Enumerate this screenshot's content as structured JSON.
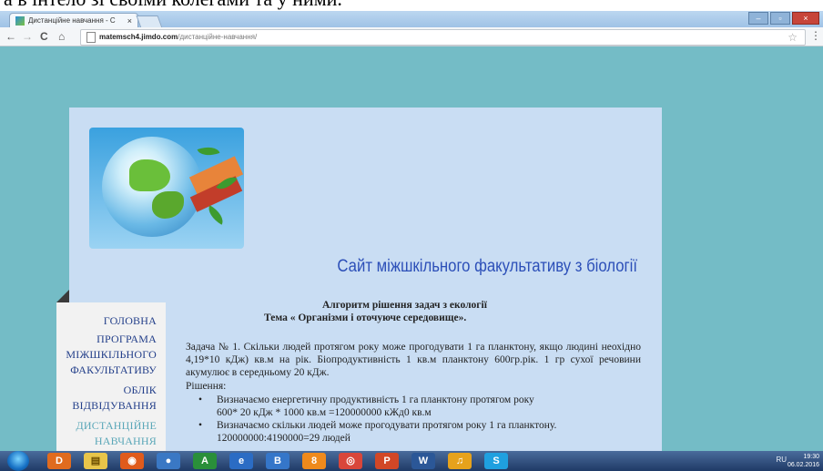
{
  "caption": "а в інтело зі своїми колегами та у ними.",
  "browser": {
    "tab_title": "Дистанційне навчання - С",
    "tab_close": "×",
    "win_min": "‒",
    "win_restore": "▫",
    "win_close": "×",
    "back": "←",
    "forward": "→",
    "reload": "C",
    "home": "⌂",
    "url_host": "matemsch4.jimdo.com",
    "url_path": "/дистанційне-навчання/",
    "bookmark": "☆",
    "menu": "⋮"
  },
  "site": {
    "title": "Сайт міжшкільного факультативу з біології"
  },
  "nav": {
    "items": [
      {
        "label": "ГОЛОВНА"
      },
      {
        "label": "ПРОГРАМА"
      },
      {
        "label": "МІЖШКІЛЬНОГО"
      },
      {
        "label": "ФАКУЛЬТАТИВУ"
      },
      {
        "label": "ОБЛІК"
      },
      {
        "label": "ВІДВІДУВАННЯ"
      },
      {
        "label": "ДИСТАНЦІЙНЕ"
      },
      {
        "label": "НАВЧАННЯ"
      }
    ]
  },
  "article": {
    "heading1": "Алгоритм рішення задач з екології",
    "heading2": "Тема « Організми і оточуюче середовище».",
    "task": "Задача № 1. Скільки людей протягом року може прогодувати 1 га планктону, якщо людині неохідно 4,19*10 кДж) кв.м на рік. Біопродуктивність 1 кв.м планктону 600гр.рік. 1 гр сухої речовини акумулює в середньому 20 кДж.",
    "solution_label": "Рішення:",
    "bullets": [
      {
        "text": "Визначаємо енергетичну продуктивність 1 га планктону протягом року",
        "sub": "600* 20 кДж * 1000 кв.м =120000000 кЖд0 кв.м"
      },
      {
        "text": "Визначаємо скільки людей може прогодувати протягом року 1 га планктону.",
        "sub": "120000000:4190000=29 людей"
      }
    ]
  },
  "taskbar": {
    "lang": "RU",
    "time": "19:30",
    "date": "06.02.2016",
    "apps": [
      "D",
      "▤",
      "◉",
      "●",
      "A",
      "e",
      "B",
      "8",
      "◎",
      "P",
      "W",
      "♫",
      "S"
    ]
  },
  "colors": {
    "page_bg": "#74bcc6",
    "content_bg": "#c9ddf3",
    "title": "#2c4fb8",
    "nav_text": "#233f8a",
    "nav_active": "#5aa7b8"
  }
}
